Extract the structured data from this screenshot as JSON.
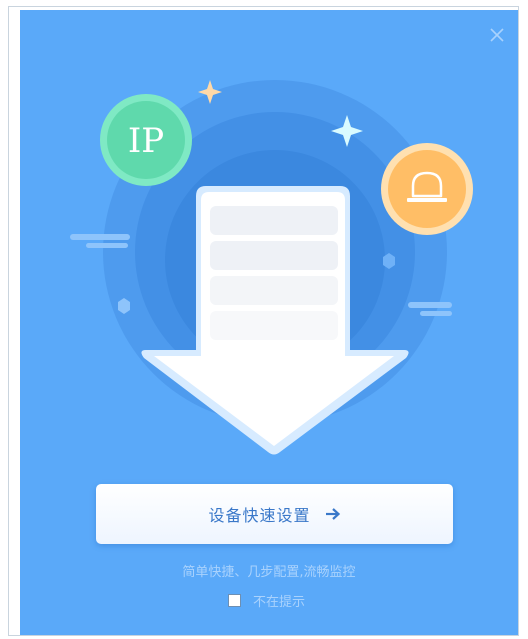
{
  "dialog": {
    "close_icon": "close-icon",
    "ip_badge_text": "IP",
    "alarm_icon": "alarm-bell-icon",
    "primary_button": {
      "label": "设备快速设置",
      "icon": "arrow-right-icon"
    },
    "subtitle": "简单快捷、几步配置,流畅监控",
    "dont_show_again": {
      "label": "不在提示",
      "checked": false
    },
    "colors": {
      "background": "#5aa9f9",
      "ip_badge": "#62dbb0",
      "alarm_badge": "#ffc06d",
      "button_text": "#3a78c9",
      "muted_text": "#a9d2fd"
    }
  }
}
